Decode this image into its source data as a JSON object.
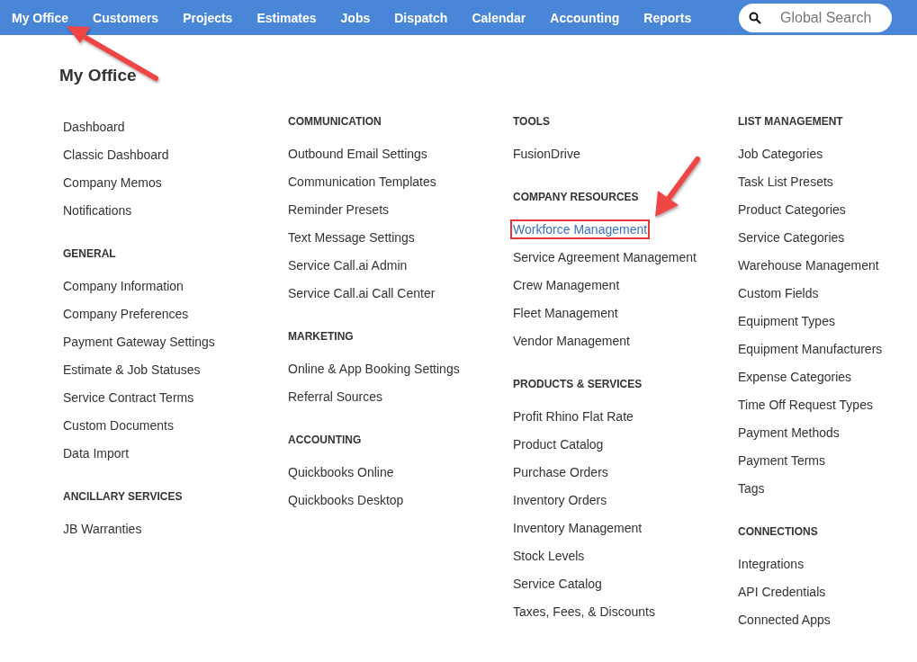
{
  "nav": {
    "tabs": [
      {
        "label": "My Office"
      },
      {
        "label": "Customers"
      },
      {
        "label": "Projects"
      },
      {
        "label": "Estimates"
      },
      {
        "label": "Jobs"
      },
      {
        "label": "Dispatch"
      },
      {
        "label": "Calendar"
      },
      {
        "label": "Accounting"
      },
      {
        "label": "Reports"
      }
    ],
    "search": {
      "placeholder": "Global Search"
    }
  },
  "page_title": "My Office",
  "columns": [
    [
      {
        "items": [
          {
            "label": "Dashboard",
            "highlighted": false
          },
          {
            "label": "Classic Dashboard",
            "highlighted": false
          },
          {
            "label": "Company Memos",
            "highlighted": false
          },
          {
            "label": "Notifications",
            "highlighted": false
          }
        ]
      },
      {
        "heading": "GENERAL",
        "items": [
          {
            "label": "Company Information",
            "highlighted": false
          },
          {
            "label": "Company Preferences",
            "highlighted": false
          },
          {
            "label": "Payment Gateway Settings",
            "highlighted": false
          },
          {
            "label": "Estimate & Job Statuses",
            "highlighted": false
          },
          {
            "label": "Service Contract Terms",
            "highlighted": false
          },
          {
            "label": "Custom Documents",
            "highlighted": false
          },
          {
            "label": "Data Import",
            "highlighted": false
          }
        ]
      },
      {
        "heading": "ANCILLARY SERVICES",
        "items": [
          {
            "label": "JB Warranties",
            "highlighted": false
          }
        ]
      }
    ],
    [
      {
        "heading": "COMMUNICATION",
        "items": [
          {
            "label": "Outbound Email Settings",
            "highlighted": false
          },
          {
            "label": "Communication Templates",
            "highlighted": false
          },
          {
            "label": "Reminder Presets",
            "highlighted": false
          },
          {
            "label": "Text Message Settings",
            "highlighted": false
          },
          {
            "label": "Service Call.ai Admin",
            "highlighted": false
          },
          {
            "label": "Service Call.ai Call Center",
            "highlighted": false
          }
        ]
      },
      {
        "heading": "MARKETING",
        "items": [
          {
            "label": "Online & App Booking Settings",
            "highlighted": false
          },
          {
            "label": "Referral Sources",
            "highlighted": false
          }
        ]
      },
      {
        "heading": "ACCOUNTING",
        "items": [
          {
            "label": "Quickbooks Online",
            "highlighted": false
          },
          {
            "label": "Quickbooks Desktop",
            "highlighted": false
          }
        ]
      }
    ],
    [
      {
        "heading": "TOOLS",
        "items": [
          {
            "label": "FusionDrive",
            "highlighted": false
          }
        ]
      },
      {
        "heading": "COMPANY RESOURCES",
        "items": [
          {
            "label": "Workforce Management",
            "highlighted": true
          },
          {
            "label": "Service Agreement Management",
            "highlighted": false
          },
          {
            "label": "Crew Management",
            "highlighted": false
          },
          {
            "label": "Fleet Management",
            "highlighted": false
          },
          {
            "label": "Vendor Management",
            "highlighted": false
          }
        ]
      },
      {
        "heading": "PRODUCTS & SERVICES",
        "items": [
          {
            "label": "Profit Rhino Flat Rate",
            "highlighted": false
          },
          {
            "label": "Product Catalog",
            "highlighted": false
          },
          {
            "label": "Purchase Orders",
            "highlighted": false
          },
          {
            "label": "Inventory Orders",
            "highlighted": false
          },
          {
            "label": "Inventory Management",
            "highlighted": false
          },
          {
            "label": "Stock Levels",
            "highlighted": false
          },
          {
            "label": "Service Catalog",
            "highlighted": false
          },
          {
            "label": "Taxes, Fees, & Discounts",
            "highlighted": false
          }
        ]
      }
    ],
    [
      {
        "heading": "LIST MANAGEMENT",
        "items": [
          {
            "label": "Job Categories",
            "highlighted": false
          },
          {
            "label": "Task List Presets",
            "highlighted": false
          },
          {
            "label": "Product Categories",
            "highlighted": false
          },
          {
            "label": "Service Categories",
            "highlighted": false
          },
          {
            "label": "Warehouse Management",
            "highlighted": false
          },
          {
            "label": "Custom Fields",
            "highlighted": false
          },
          {
            "label": "Equipment Types",
            "highlighted": false
          },
          {
            "label": "Equipment Manufacturers",
            "highlighted": false
          },
          {
            "label": "Expense Categories",
            "highlighted": false
          },
          {
            "label": "Time Off Request Types",
            "highlighted": false
          },
          {
            "label": "Payment Methods",
            "highlighted": false
          },
          {
            "label": "Payment Terms",
            "highlighted": false
          },
          {
            "label": "Tags",
            "highlighted": false
          }
        ]
      },
      {
        "heading": "CONNECTIONS",
        "items": [
          {
            "label": "Integrations",
            "highlighted": false
          },
          {
            "label": "API Credentials",
            "highlighted": false
          },
          {
            "label": "Connected Apps",
            "highlighted": false
          }
        ]
      }
    ]
  ]
}
